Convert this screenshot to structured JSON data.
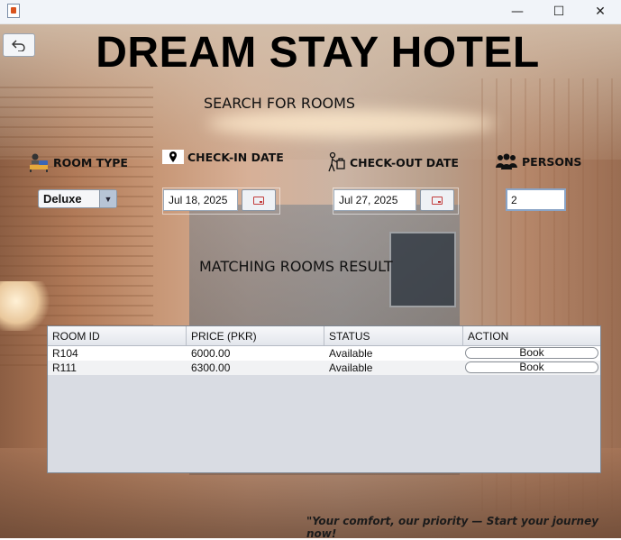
{
  "window": {
    "minimize_glyph": "—",
    "maximize_glyph": "☐",
    "close_glyph": "✕"
  },
  "header": {
    "title": "DREAM STAY HOTEL",
    "back_icon": "undo-arrow-icon"
  },
  "search": {
    "title": "SEARCH FOR ROOMS",
    "room_type_label": "ROOM TYPE",
    "checkin_label": "CHECK-IN DATE",
    "checkout_label": "CHECK-OUT DATE",
    "persons_label": "PERSONS",
    "room_type_value": "Deluxe",
    "checkin_value": "Jul 18, 2025",
    "checkout_value": "Jul 27, 2025",
    "persons_value": "2"
  },
  "results": {
    "title": "MATCHING ROOMS RESULT",
    "columns": [
      "ROOM ID",
      "PRICE (PKR)",
      "STATUS",
      "ACTION"
    ],
    "rows": [
      {
        "room_id": "R104",
        "price": "6000.00",
        "status": "Available",
        "action": "Book"
      },
      {
        "room_id": "R111",
        "price": "6300.00",
        "status": "Available",
        "action": "Book"
      }
    ]
  },
  "footer": {
    "tagline": "\"Your comfort, our priority — Start your journey now!"
  }
}
